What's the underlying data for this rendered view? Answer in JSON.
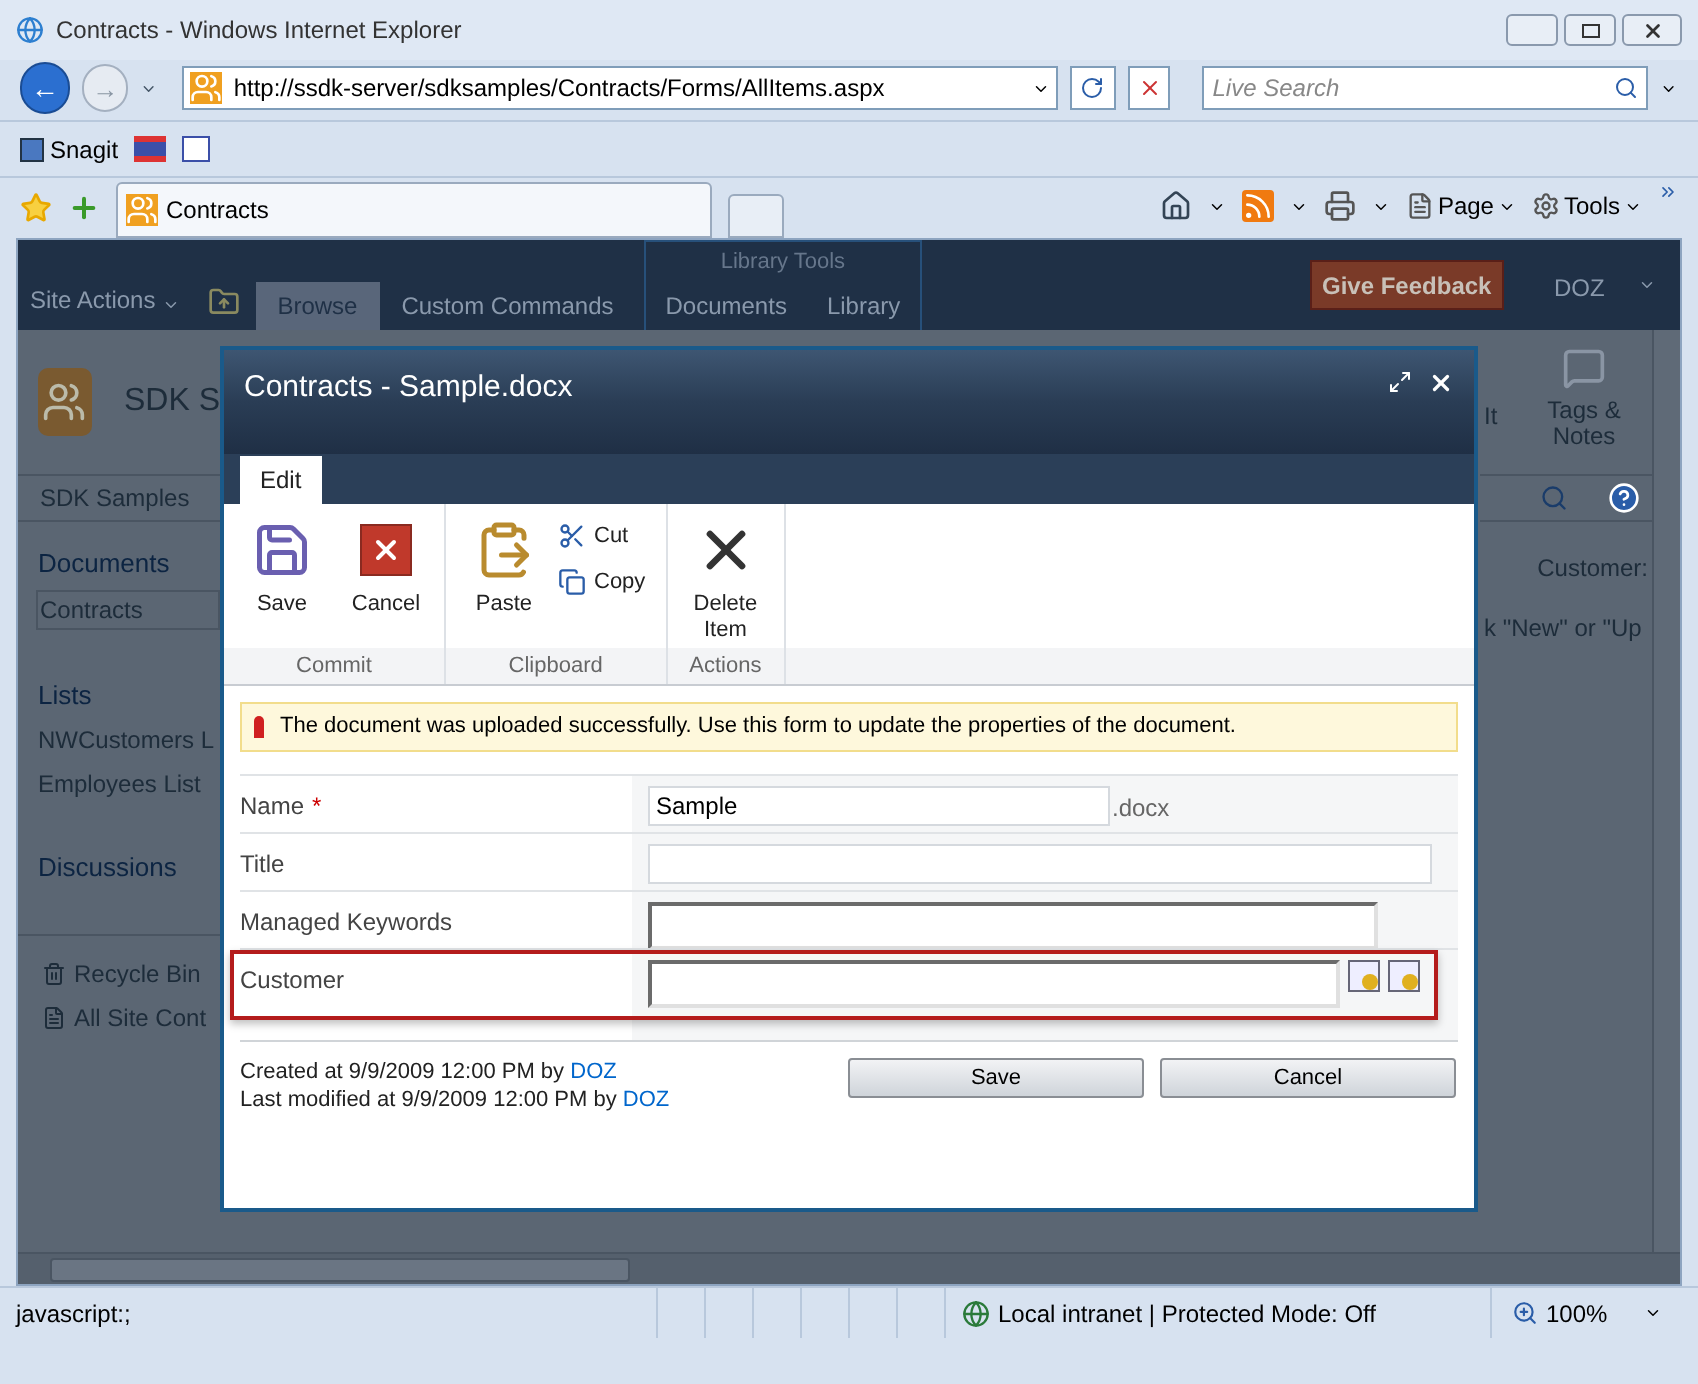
{
  "browser": {
    "title": "Contracts - Windows Internet Explorer",
    "back": "←",
    "forward": "→",
    "address": "http://ssdk-server/sdksamples/Contracts/Forms/AllItems.aspx",
    "search": {
      "placeholder": "Live Search"
    },
    "links": [
      "Snagit"
    ],
    "tab": "Contracts",
    "page_menu": "Page",
    "tools_menu": "Tools"
  },
  "ribbon": {
    "site_actions": "Site Actions",
    "context_group": "Library Tools",
    "tabs": [
      {
        "label": "Browse",
        "selected": true
      },
      {
        "label": "Custom Commands",
        "selected": false
      },
      {
        "label": "Documents",
        "selected": false
      },
      {
        "label": "Library",
        "selected": false
      }
    ],
    "feedback": "Give Feedback",
    "user": "DOZ"
  },
  "page": {
    "site_title": "SDK S",
    "top_nav": "SDK Samples",
    "quick_launch": [
      {
        "heading": "Documents",
        "items": [
          {
            "label": "Contracts",
            "selected": true
          }
        ]
      },
      {
        "heading": "Lists",
        "items": [
          {
            "label": "NWCustomers L",
            "selected": false
          },
          {
            "label": "Employees List",
            "selected": false
          }
        ]
      },
      {
        "heading": "Discussions"
      }
    ],
    "bottom_links": [
      {
        "label": "Recycle Bin",
        "kind": "bin"
      },
      {
        "label": "All Site Cont",
        "kind": "doc"
      }
    ],
    "ribbon_buttons": [
      "It",
      "Tags & Notes"
    ],
    "column_heading": "Customer:",
    "hint": "k \"New\" or \"Up"
  },
  "dialog": {
    "title": "Contracts - Sample.docx",
    "tab": "Edit",
    "groups": [
      {
        "label": "Commit",
        "buttons": [
          {
            "label": "Save",
            "kind": "save"
          },
          {
            "label": "Cancel",
            "kind": "cancel"
          }
        ]
      },
      {
        "label": "Clipboard",
        "buttons": [
          {
            "label": "Paste",
            "kind": "paste"
          },
          {
            "label": "Cut",
            "kind": "cut"
          },
          {
            "label": "Copy",
            "kind": "copy"
          }
        ]
      },
      {
        "label": "Actions",
        "buttons": [
          {
            "label": "Delete Item",
            "kind": "delete"
          }
        ]
      }
    ],
    "message": "The document was uploaded successfully. Use this form to update the properties of the document.",
    "fields": [
      {
        "label": "Name",
        "required_mark": "*",
        "value": "Sample",
        "suffix": ".docx",
        "kind": "text",
        "highlighted": false
      },
      {
        "label": "Title",
        "kind": "text",
        "highlighted": false
      },
      {
        "label": "Managed Keywords",
        "kind": "keywords",
        "highlighted": false
      },
      {
        "label": "Customer",
        "kind": "lookup",
        "highlighted": true
      }
    ],
    "created": {
      "text": "Created at 9/9/2009 12:00 PM by",
      "user": "DOZ"
    },
    "modified": {
      "text": "Last modified at 9/9/2009 12:00 PM by",
      "user": "DOZ"
    },
    "buttons": [
      "Save",
      "Cancel"
    ]
  },
  "status_bar": {
    "text": "javascript:;",
    "zone": "Local intranet | Protected Mode: Off",
    "zoom": "100%"
  }
}
